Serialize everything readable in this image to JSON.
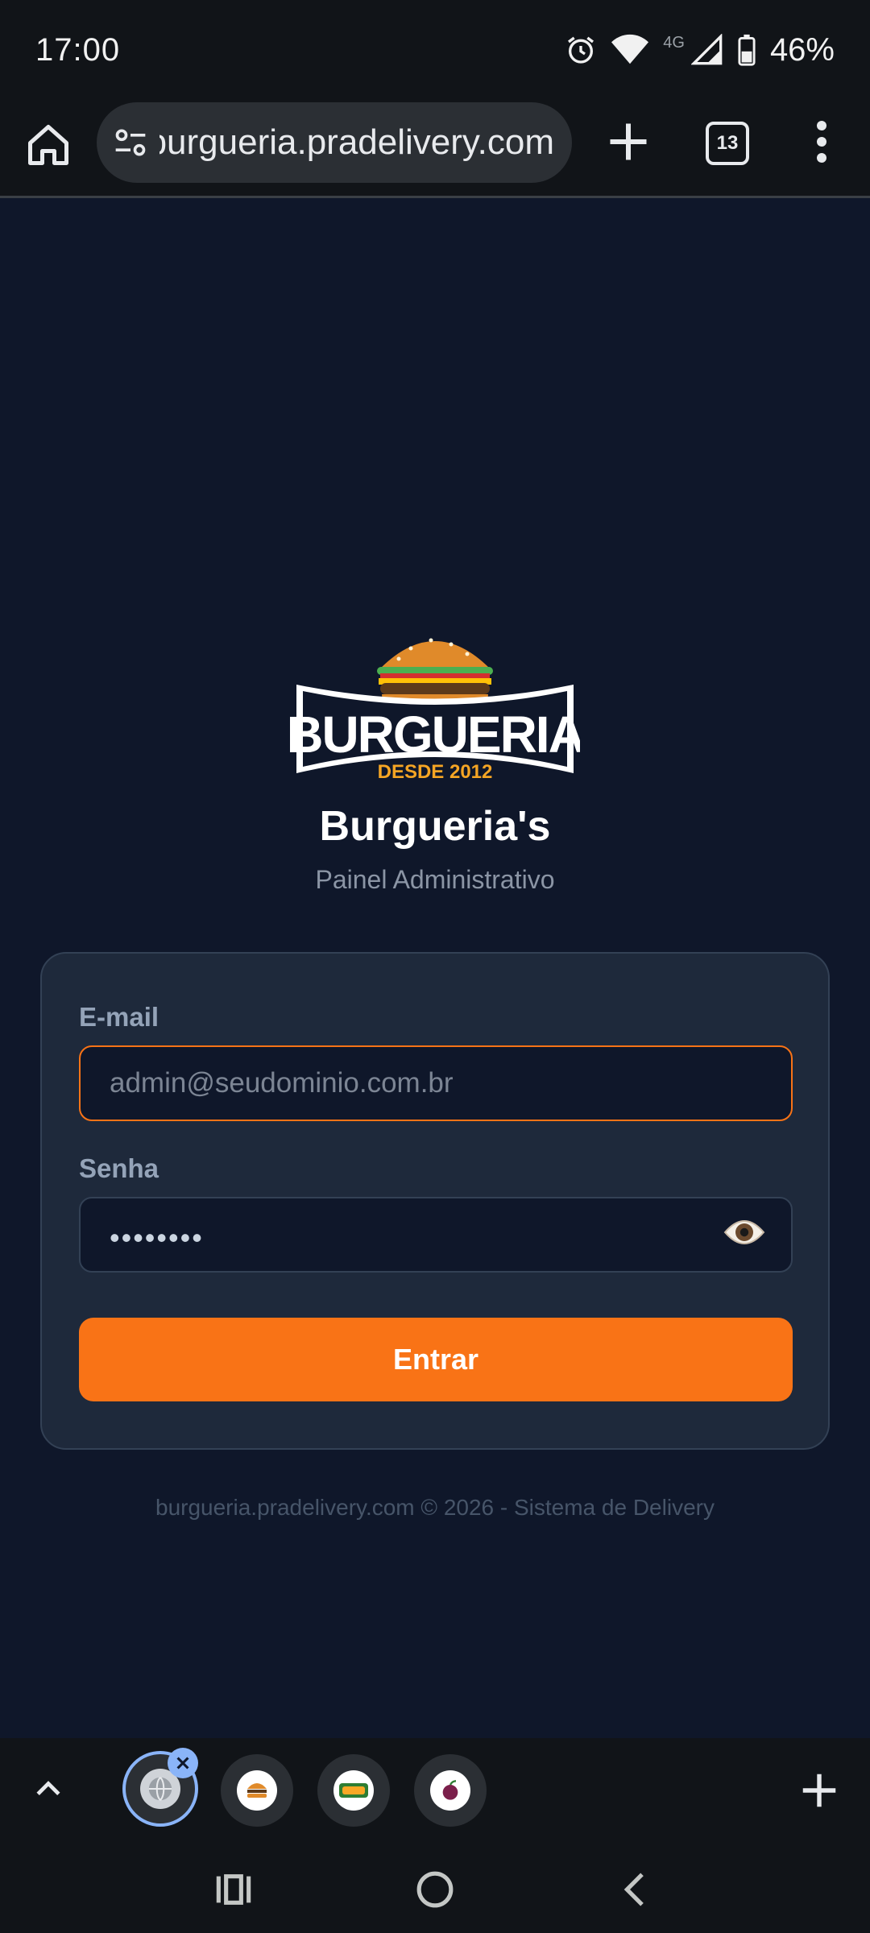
{
  "status_bar": {
    "time": "17:00",
    "network": "4G",
    "battery": "46%",
    "icons": [
      "alarm-icon",
      "wifi-icon",
      "signal-icon",
      "battery-icon"
    ]
  },
  "browser": {
    "url": "burgueria.pradelivery.com",
    "tab_count": "13",
    "icons": [
      "home-icon",
      "site-settings-icon",
      "new-tab-icon",
      "tab-switcher-icon",
      "more-menu-icon"
    ]
  },
  "logo": {
    "wordmark": "BURGUERIA",
    "tagline": "DESDE 2012"
  },
  "brand": {
    "title": "Burgueria's",
    "subtitle": "Painel Administrativo"
  },
  "form": {
    "email_label": "E-mail",
    "email_placeholder": "admin@seudominio.com.br",
    "password_label": "Senha",
    "password_mask": "••••••••",
    "submit_label": "Entrar"
  },
  "footer": {
    "text": "burgueria.pradelivery.com © 2026 - Sistema de Delivery"
  },
  "tab_strip": {
    "tabs": [
      "globe-icon",
      "burger-icon",
      "food-logo-icon",
      "fruit-icon"
    ],
    "active_index": 0
  },
  "colors": {
    "page_bg": "#0f172a",
    "card_bg": "#1e293b",
    "accent": "#f97316",
    "muted_text": "#94a3b8"
  }
}
